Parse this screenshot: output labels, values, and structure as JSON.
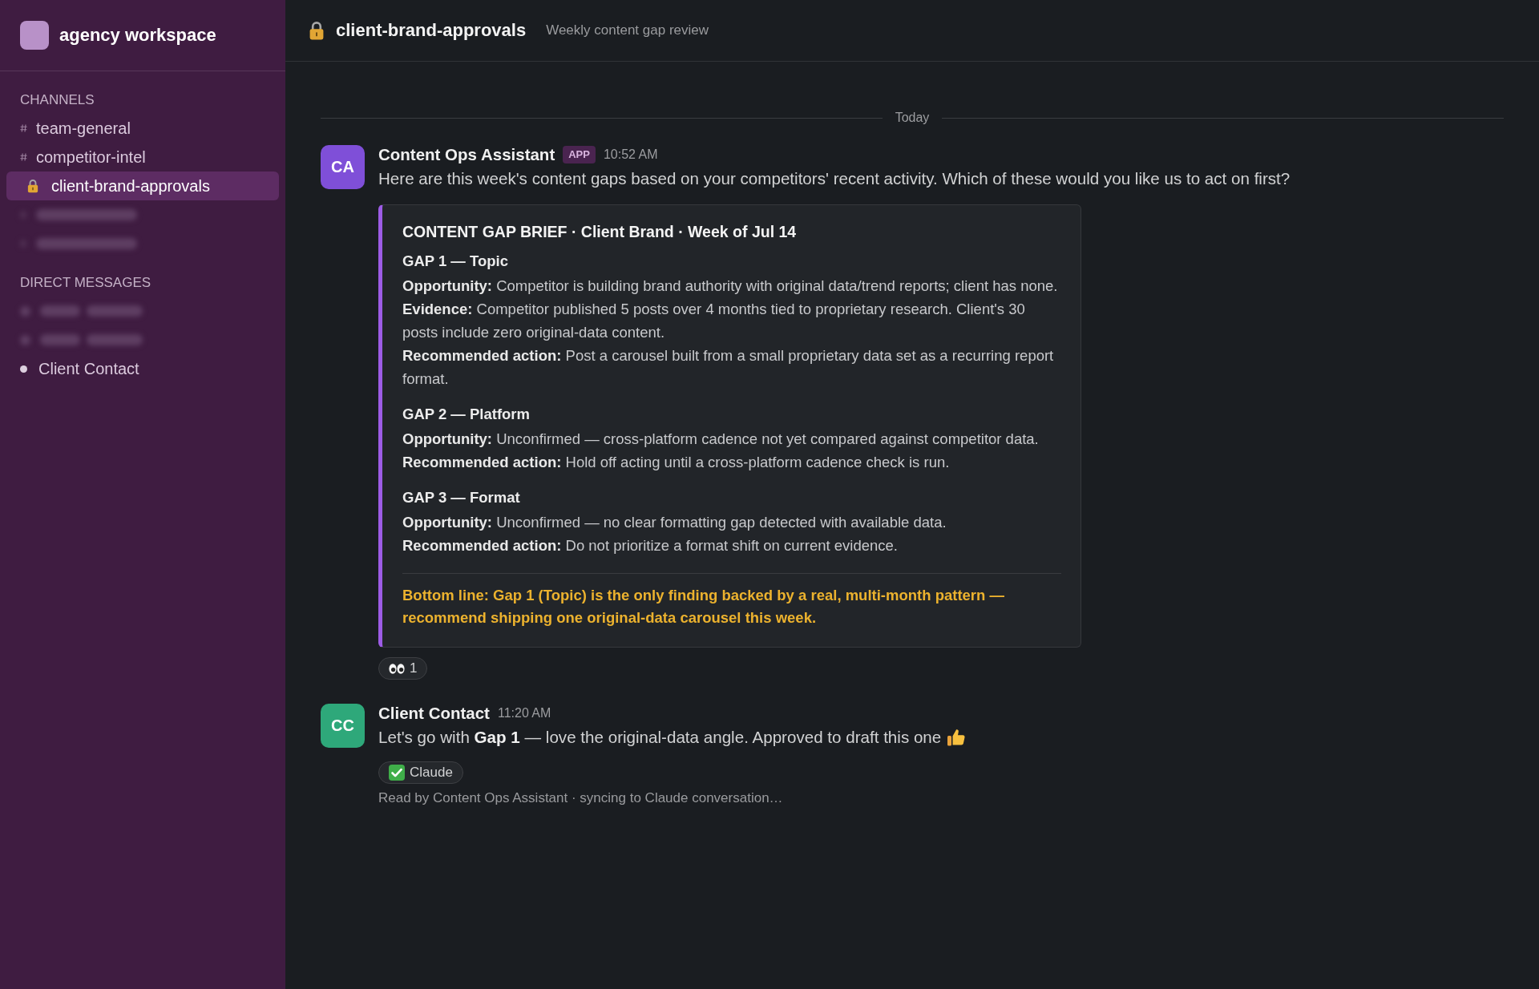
{
  "sidebar": {
    "workspace": {
      "name": "agency workspace"
    },
    "sections": [
      {
        "title": "CHANNELS",
        "items": [
          {
            "kind": "public",
            "label": "team-general",
            "selected": false
          },
          {
            "kind": "public",
            "label": "competitor-intel",
            "selected": false
          },
          {
            "kind": "private",
            "label": "client-brand-approvals",
            "selected": true
          },
          {
            "kind": "blurred",
            "selected": false
          },
          {
            "kind": "blurred",
            "selected": false
          }
        ]
      },
      {
        "title": "DIRECT MESSAGES",
        "items": [
          {
            "kind": "blurred_dm",
            "selected": false
          },
          {
            "kind": "blurred_dm",
            "selected": false
          },
          {
            "kind": "dm",
            "label": "Client Contact",
            "selected": false
          }
        ]
      }
    ]
  },
  "channel_header": {
    "private": true,
    "name": "client-brand-approvals",
    "topic": "Weekly content gap review"
  },
  "date_divider": "Today",
  "messages": [
    {
      "initials": "CA",
      "color": "#7f4fd8",
      "author": "Content Ops Assistant",
      "badge": "APP",
      "time": "10:52 AM",
      "text": "Here are this week's content gaps based on your competitors' recent activity. Which of these would you like us to act on first?",
      "attachment": {
        "title": "CONTENT GAP BRIEF · Client Brand · Week of Jul 14",
        "sections": [
          {
            "heading": "GAP 1 — Topic",
            "lines": [
              "**Opportunity:** Competitor is building brand authority with original data/trend reports; client has none.",
              "**Evidence:** Competitor published 5 posts over 4 months tied to proprietary research. Client's 30 posts include zero original-data content.",
              "**Recommended action:** Post a carousel built from a small proprietary data set as a recurring report format."
            ]
          },
          {
            "heading": "GAP 2 — Platform",
            "lines": [
              "**Opportunity:** Unconfirmed — cross-platform cadence not yet compared against competitor data.",
              "**Recommended action:** Hold off acting until a cross-platform cadence check is run."
            ]
          },
          {
            "heading": "GAP 3 — Format",
            "lines": [
              "**Opportunity:** Unconfirmed — no clear formatting gap detected with available data.",
              "**Recommended action:** Do not prioritize a format shift on current evidence."
            ]
          }
        ],
        "bottom_line": "Bottom line: Gap 1 (Topic) is the only finding backed by a real, multi-month pattern — recommend shipping one original-data carousel this week."
      },
      "reactions": [
        {
          "kind": "seen",
          "label": "1"
        }
      ]
    },
    {
      "initials": "CC",
      "color": "#2ea87a",
      "author": "Client Contact",
      "time": "11:20 AM",
      "text": "Let's go with **Gap 1** — love the original-data angle. Approved to draft this one",
      "thumbs_up": true,
      "reactions": [
        {
          "kind": "approved",
          "label": "Claude"
        }
      ],
      "receipt": "Read by Content Ops Assistant · syncing to Claude conversation…"
    }
  ]
}
